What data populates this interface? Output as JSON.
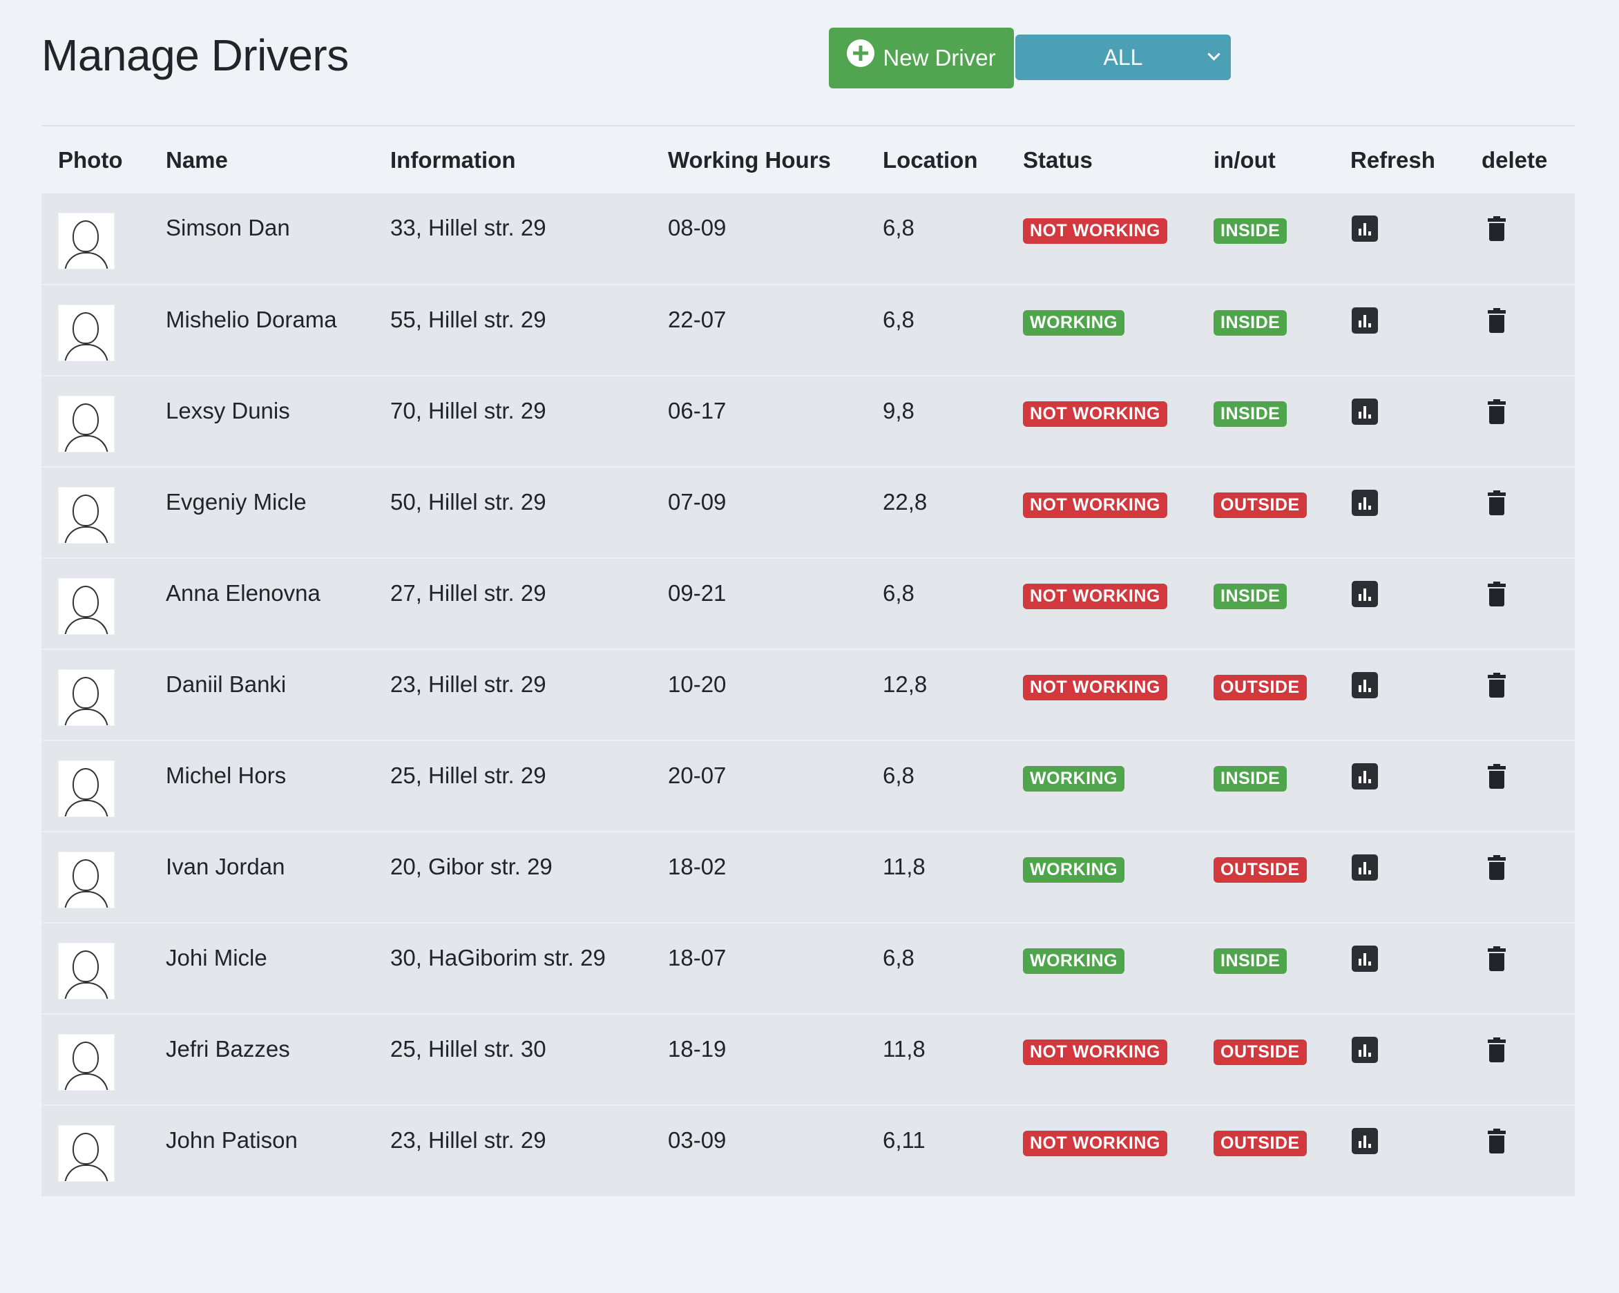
{
  "header": {
    "title": "Manage Drivers",
    "new_driver_label": "New Driver",
    "filter_value": "ALL"
  },
  "table": {
    "columns": [
      "Photo",
      "Name",
      "Information",
      "Working Hours",
      "Location",
      "Status",
      "in/out",
      "Refresh",
      "delete"
    ],
    "rows": [
      {
        "name": "Simson Dan",
        "info": "33, Hillel str. 29",
        "hours": "08-09",
        "location": "6,8",
        "status": "NOT WORKING",
        "inout": "INSIDE"
      },
      {
        "name": "Mishelio Dorama",
        "info": "55, Hillel str. 29",
        "hours": "22-07",
        "location": "6,8",
        "status": "WORKING",
        "inout": "INSIDE"
      },
      {
        "name": "Lexsy Dunis",
        "info": "70, Hillel str. 29",
        "hours": "06-17",
        "location": "9,8",
        "status": "NOT WORKING",
        "inout": "INSIDE"
      },
      {
        "name": "Evgeniy Micle",
        "info": "50, Hillel str. 29",
        "hours": "07-09",
        "location": "22,8",
        "status": "NOT WORKING",
        "inout": "OUTSIDE"
      },
      {
        "name": "Anna Elenovna",
        "info": "27, Hillel str. 29",
        "hours": "09-21",
        "location": "6,8",
        "status": "NOT WORKING",
        "inout": "INSIDE"
      },
      {
        "name": "Daniil Banki",
        "info": "23, Hillel str. 29",
        "hours": "10-20",
        "location": "12,8",
        "status": "NOT WORKING",
        "inout": "OUTSIDE"
      },
      {
        "name": "Michel Hors",
        "info": "25, Hillel str. 29",
        "hours": "20-07",
        "location": "6,8",
        "status": "WORKING",
        "inout": "INSIDE"
      },
      {
        "name": "Ivan Jordan",
        "info": "20, Gibor str. 29",
        "hours": "18-02",
        "location": "11,8",
        "status": "WORKING",
        "inout": "OUTSIDE"
      },
      {
        "name": "Johi Micle",
        "info": "30, HaGiborim str. 29",
        "hours": "18-07",
        "location": "6,8",
        "status": "WORKING",
        "inout": "INSIDE"
      },
      {
        "name": "Jefri Bazzes",
        "info": "25, Hillel str. 30",
        "hours": "18-19",
        "location": "11,8",
        "status": "NOT WORKING",
        "inout": "OUTSIDE"
      },
      {
        "name": "John Patison",
        "info": "23, Hillel str. 29",
        "hours": "03-09",
        "location": "6,11",
        "status": "NOT WORKING",
        "inout": "OUTSIDE"
      }
    ]
  },
  "colors": {
    "background": "#eff2f6",
    "row_background": "#e3e6ea",
    "new_driver_button": "#52a550",
    "filter_select": "#4ba0b6",
    "badge_red": "#d2393f",
    "badge_green": "#4ea54b"
  },
  "icons": {
    "new_driver": "plus-circle-icon",
    "filter": "chevron-down-icon",
    "refresh": "bar-chart-icon",
    "delete": "trash-icon",
    "photo": "avatar"
  }
}
